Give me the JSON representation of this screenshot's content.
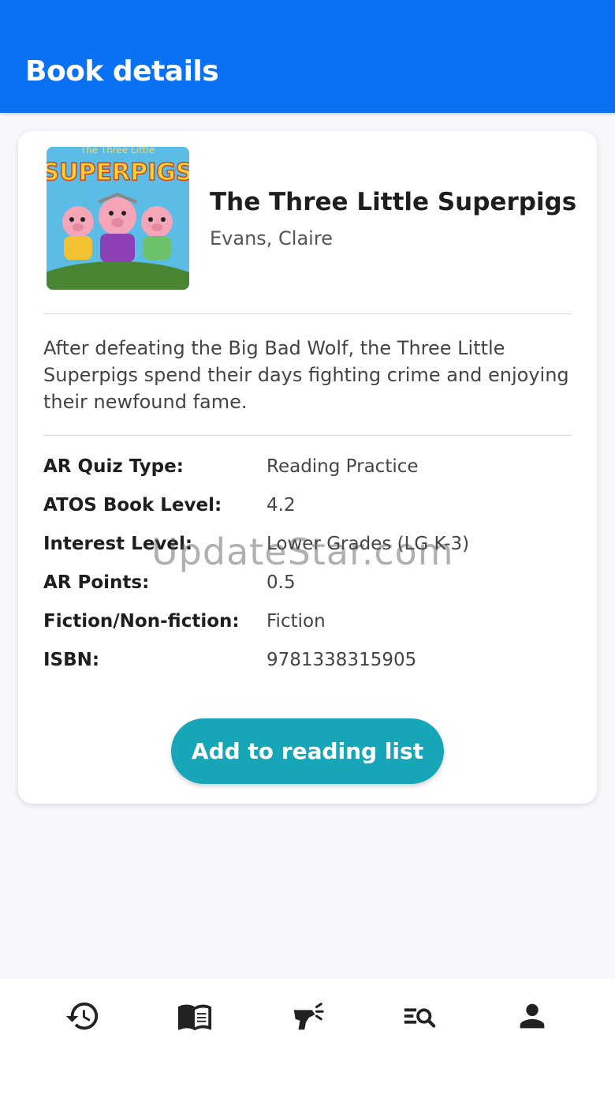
{
  "header": {
    "title": "Book details"
  },
  "book": {
    "cover_title_text": "The Three Little SUPERPIGS",
    "title": "The Three Little Superpigs",
    "author": "Evans, Claire",
    "description": "After defeating the Big Bad Wolf, the Three Little Superpigs spend their days fighting crime and enjoying their newfound fame.",
    "details": [
      {
        "label": "AR Quiz Type:",
        "value": "Reading Practice"
      },
      {
        "label": "ATOS Book Level:",
        "value": "4.2"
      },
      {
        "label": "Interest Level:",
        "value": "Lower Grades (LG K-3)"
      },
      {
        "label": "AR Points:",
        "value": "0.5"
      },
      {
        "label": "Fiction/Non-fiction:",
        "value": "Fiction"
      },
      {
        "label": "ISBN:",
        "value": "9781338315905"
      }
    ]
  },
  "actions": {
    "add_label": "Add to reading list"
  },
  "watermark": "UpdateStar.com",
  "nav": {
    "items": [
      {
        "icon": "history-icon"
      },
      {
        "icon": "book-open-icon"
      },
      {
        "icon": "barcode-scanner-icon"
      },
      {
        "icon": "search-list-icon"
      },
      {
        "icon": "person-icon"
      }
    ]
  },
  "colors": {
    "app_bar": "#0a72f2",
    "button": "#17a6b8",
    "background": "#f6f8fb"
  }
}
